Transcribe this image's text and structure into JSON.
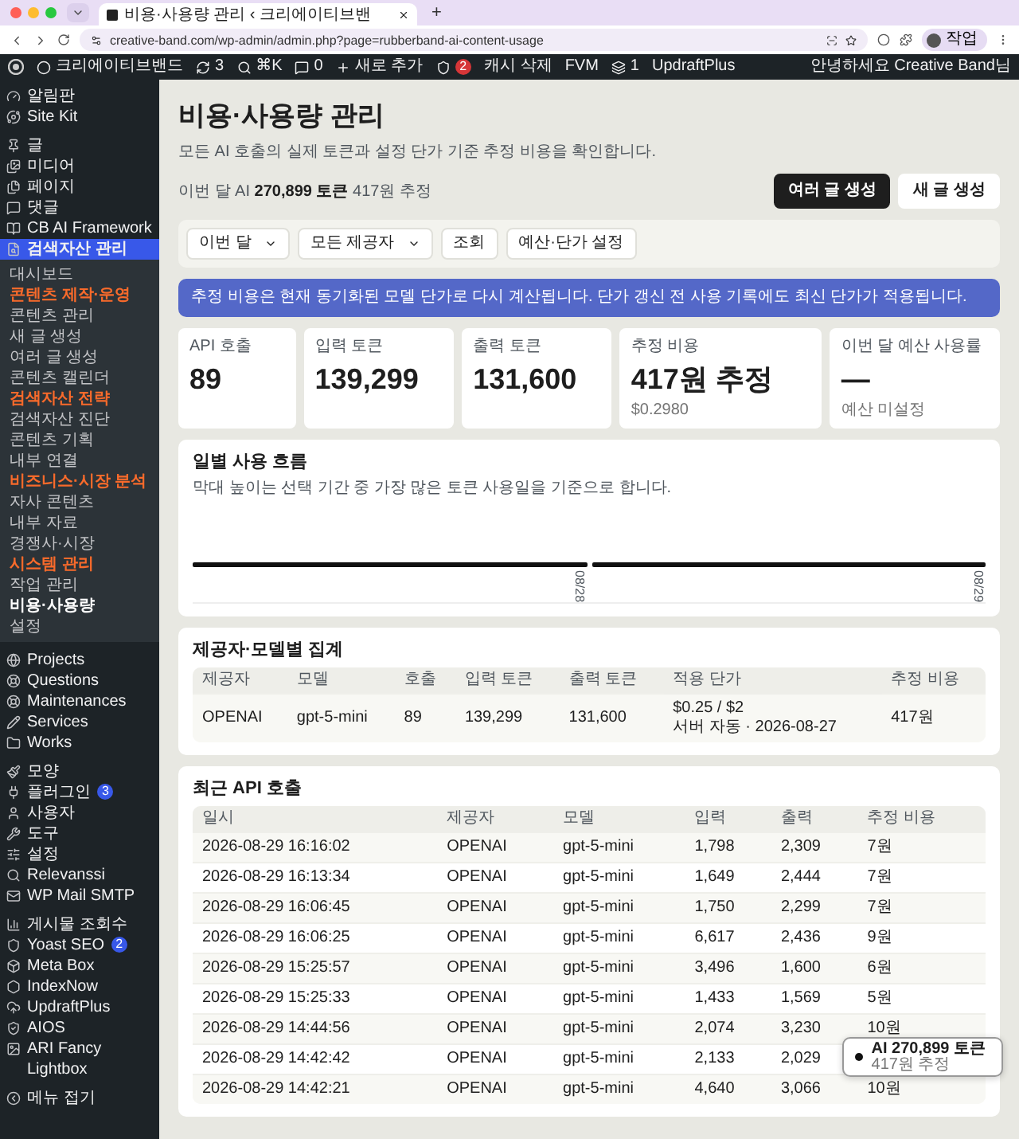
{
  "browser": {
    "tab_title": "비용·사용량 관리 ‹ 크리에이티브밴",
    "new_tab": "+",
    "url": "creative-band.com/wp-admin/admin.php?page=rubberband-ai-content-usage",
    "profile": "작업"
  },
  "admin_bar": {
    "items": [
      {
        "kind": "site",
        "label": "크리에이티브밴드"
      },
      {
        "kind": "updates",
        "label": "3"
      },
      {
        "kind": "search",
        "label": "⌘K"
      },
      {
        "kind": "comments",
        "label": "0"
      },
      {
        "kind": "new",
        "label": "새로 추가"
      },
      {
        "kind": "seo",
        "label": "2"
      },
      {
        "kind": "text",
        "label": "캐시 삭제"
      },
      {
        "kind": "text",
        "label": "FVM"
      },
      {
        "kind": "cache",
        "label": "1"
      },
      {
        "kind": "text",
        "label": "UpdraftPlus"
      }
    ],
    "greeting": "안녕하세요 Creative Band님"
  },
  "sidebar": {
    "groups": [
      {
        "items": [
          {
            "label": "알림판",
            "selected": false
          },
          {
            "label": "Site Kit",
            "selected": false
          }
        ]
      },
      {
        "items": [
          {
            "label": "글",
            "selected": false
          },
          {
            "label": "미디어",
            "selected": false
          },
          {
            "label": "페이지",
            "selected": false
          },
          {
            "label": "댓글",
            "selected": false
          },
          {
            "label": "CB AI Framework",
            "selected": false
          },
          {
            "label": "검색자산 관리",
            "selected": true,
            "submenu": [
              {
                "kind": "link",
                "label": "대시보드",
                "selected": false
              },
              {
                "kind": "heading",
                "label": "콘텐츠 제작·운영"
              },
              {
                "kind": "link",
                "label": "콘텐츠 관리",
                "selected": false
              },
              {
                "kind": "link",
                "label": "새 글 생성",
                "selected": false
              },
              {
                "kind": "link",
                "label": "여러 글 생성",
                "selected": false
              },
              {
                "kind": "link",
                "label": "콘텐츠 캘린더",
                "selected": false
              },
              {
                "kind": "heading",
                "label": "검색자산 전략"
              },
              {
                "kind": "link",
                "label": "검색자산 진단",
                "selected": false
              },
              {
                "kind": "link",
                "label": "콘텐츠 기획",
                "selected": false
              },
              {
                "kind": "link",
                "label": "내부 연결",
                "selected": false
              },
              {
                "kind": "heading",
                "label": "비즈니스·시장 분석"
              },
              {
                "kind": "link",
                "label": "자사 콘텐츠",
                "selected": false
              },
              {
                "kind": "link",
                "label": "내부 자료",
                "selected": false
              },
              {
                "kind": "link",
                "label": "경쟁사·시장",
                "selected": false
              },
              {
                "kind": "heading",
                "label": "시스템 관리"
              },
              {
                "kind": "link",
                "label": "작업 관리",
                "selected": false
              },
              {
                "kind": "link",
                "label": "비용·사용량",
                "selected": true
              },
              {
                "kind": "link",
                "label": "설정",
                "selected": false
              }
            ]
          }
        ]
      },
      {
        "items": [
          {
            "label": "Projects",
            "selected": false
          },
          {
            "label": "Questions",
            "selected": false
          },
          {
            "label": "Maintenances",
            "selected": false
          },
          {
            "label": "Services",
            "selected": false
          },
          {
            "label": "Works",
            "selected": false
          }
        ]
      },
      {
        "items": [
          {
            "label": "모양",
            "selected": false
          },
          {
            "label": "플러그인",
            "selected": false,
            "badge": "3"
          },
          {
            "label": "사용자",
            "selected": false
          },
          {
            "label": "도구",
            "selected": false
          },
          {
            "label": "설정",
            "selected": false
          },
          {
            "label": "Relevanssi",
            "selected": false
          },
          {
            "label": "WP Mail SMTP",
            "selected": false
          }
        ]
      },
      {
        "items": [
          {
            "label": "게시물 조회수",
            "selected": false
          },
          {
            "label": "Yoast SEO",
            "selected": false,
            "badge": "2"
          },
          {
            "label": "Meta Box",
            "selected": false
          },
          {
            "label": "IndexNow",
            "selected": false
          },
          {
            "label": "UpdraftPlus",
            "selected": false
          },
          {
            "label": "AIOS",
            "selected": false
          },
          {
            "label": "ARI Fancy Lightbox",
            "selected": false
          }
        ]
      }
    ],
    "collapse": "메뉴 접기"
  },
  "page": {
    "title": "비용·사용량 관리",
    "subtitle": "모든 AI 호출의 실제 토큰과 설정 단가 기준 추정 비용을 확인합니다.",
    "month_summary": "이번 달 AI **270,899 토큰** 417원 추정",
    "actions": [
      {
        "label": "여러 글 생성",
        "primary": true
      },
      {
        "label": "새 글 생성",
        "primary": false
      }
    ]
  },
  "filters": [
    {
      "kind": "select",
      "label": "이번 달"
    },
    {
      "kind": "select",
      "label": "모든 제공자"
    },
    {
      "kind": "button",
      "label": "조회"
    },
    {
      "kind": "button",
      "label": "예산·단가 설정"
    }
  ],
  "notice": "추정 비용은 현재 동기화된 모델 단가로 다시 계산됩니다. 단가 갱신 전 사용 기록에도 최신 단가가 적용됩니다.",
  "stats": [
    {
      "label": "API 호출",
      "value": "89"
    },
    {
      "label": "입력 토큰",
      "value": "139,299"
    },
    {
      "label": "출력 토큰",
      "value": "131,600"
    },
    {
      "label": "추정 비용",
      "value": "417원 추정",
      "note": "$0.2980"
    },
    {
      "label": "이번 달 예산 사용률",
      "value": "—",
      "note": "예산 미설정"
    }
  ],
  "daily_chart": {
    "title": "일별 사용 흐름",
    "note": "막대 높이는 선택 기간 중 가장 많은 토큰 사용일을 기준으로 합니다.",
    "days": [
      "08/28",
      "08/29"
    ]
  },
  "provider_summary": {
    "title": "제공자·모델별 집계",
    "columns": [
      "제공자",
      "모델",
      "호출",
      "입력 토큰",
      "출력 토큰",
      "적용 단가",
      "추정 비용"
    ],
    "rows": [
      {
        "provider": "OPENAI",
        "model": "gpt-5-mini",
        "calls": "89",
        "input": "139,299",
        "output": "131,600",
        "price": "$0.25 / $2",
        "price_source": "서버 자동 · 2026-08-27",
        "cost": "417원"
      }
    ]
  },
  "recent_calls": {
    "title": "최근 API 호출",
    "columns": [
      "일시",
      "제공자",
      "모델",
      "입력",
      "출력",
      "추정 비용"
    ],
    "rows": [
      [
        "2026-08-29 16:16:02",
        "OPENAI",
        "gpt-5-mini",
        "1,798",
        "2,309",
        "7원"
      ],
      [
        "2026-08-29 16:13:34",
        "OPENAI",
        "gpt-5-mini",
        "1,649",
        "2,444",
        "7원"
      ],
      [
        "2026-08-29 16:06:45",
        "OPENAI",
        "gpt-5-mini",
        "1,750",
        "2,299",
        "7원"
      ],
      [
        "2026-08-29 16:06:25",
        "OPENAI",
        "gpt-5-mini",
        "6,617",
        "2,436",
        "9원"
      ],
      [
        "2026-08-29 15:25:57",
        "OPENAI",
        "gpt-5-mini",
        "3,496",
        "1,600",
        "6원"
      ],
      [
        "2026-08-29 15:25:33",
        "OPENAI",
        "gpt-5-mini",
        "1,433",
        "1,569",
        "5원"
      ],
      [
        "2026-08-29 14:44:56",
        "OPENAI",
        "gpt-5-mini",
        "2,074",
        "3,230",
        "10원"
      ],
      [
        "2026-08-29 14:42:42",
        "OPENAI",
        "gpt-5-mini",
        "2,133",
        "2,029"
      ],
      [
        "2026-08-29 14:42:21",
        "OPENAI",
        "gpt-5-mini",
        "4,640",
        "3,066",
        "10원"
      ]
    ]
  },
  "toast": {
    "title": "AI 270,899 토큰",
    "note": "417원 추정"
  }
}
